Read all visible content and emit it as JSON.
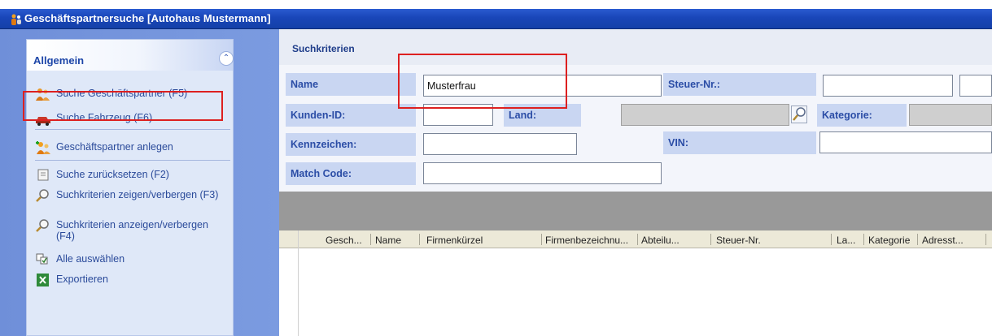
{
  "window": {
    "title": "Geschäftspartnersuche [Autohaus Mustermann]"
  },
  "sidebar": {
    "group_title": "Allgemein",
    "collapse_glyph": "⌃",
    "items": [
      {
        "label": "Suche Geschäftspartner (F5)",
        "icon": "people-search-icon"
      },
      {
        "label": "Suche Fahrzeug (F6)",
        "icon": "car-icon"
      },
      {
        "label": "Geschäftspartner anlegen",
        "icon": "add-people-icon"
      },
      {
        "label": "Suche zurücksetzen (F2)",
        "icon": "reset-icon"
      },
      {
        "label": "Suchkriterien zeigen/verbergen (F3)",
        "icon": "magnifier-icon"
      },
      {
        "label": "Suchkriterien anzeigen/verbergen (F4)",
        "icon": "magnifier-icon"
      },
      {
        "label": "Alle auswählen",
        "icon": "select-all-icon"
      },
      {
        "label": "Exportieren",
        "icon": "excel-export-icon"
      }
    ]
  },
  "criteria": {
    "title": "Suchkriterien",
    "labels": {
      "name": "Name",
      "kunden_id": "Kunden-ID:",
      "kennzeichen": "Kennzeichen:",
      "match_code": "Match Code:",
      "land": "Land:",
      "steuer_nr": "Steuer-Nr.:",
      "kategorie": "Kategorie:",
      "vin": "VIN:"
    },
    "values": {
      "name": "Musterfrau",
      "kunden_id": "",
      "kennzeichen": "",
      "match_code": "",
      "land": "",
      "steuer_nr": "",
      "kategorie": "",
      "vin": ""
    }
  },
  "grid": {
    "columns": [
      "Gesch...",
      "Name",
      "Firmenkürzel",
      "Firmenbezeichnu...",
      "Abteilu...",
      "Steuer-Nr.",
      "La...",
      "Kategorie",
      "Adresst..."
    ]
  },
  "colors": {
    "title_bar": "#1946b8",
    "annotation": "#dd2020",
    "label_bg": "#c9d6f2"
  }
}
